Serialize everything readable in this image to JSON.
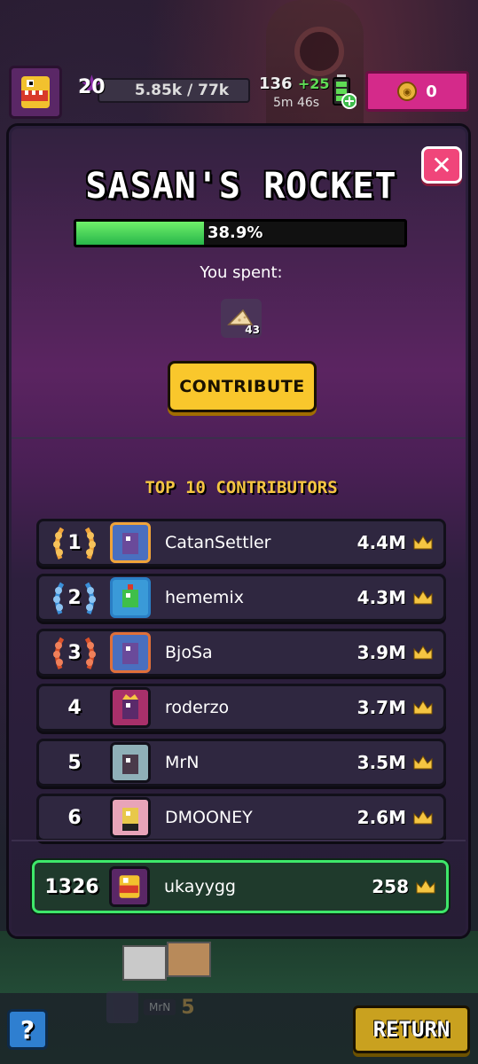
{
  "hud": {
    "level": "20",
    "xp": "5.85k / 77k",
    "energy": "136",
    "energy_plus": "+25",
    "timer": "5m 46s",
    "coins": "0"
  },
  "modal": {
    "title": "SASAN'S ROCKET",
    "progress_text": "38.9%",
    "progress_value": 38.9,
    "spent_label": "You spent:",
    "spent_count": "43",
    "contribute_label": "CONTRIBUTE",
    "close_label": "✕",
    "top_title": "TOP 10 CONTRIBUTORS"
  },
  "contributors": [
    {
      "rank": "1",
      "name": "CatanSettler",
      "score": "4.4M"
    },
    {
      "rank": "2",
      "name": "hememix",
      "score": "4.3M"
    },
    {
      "rank": "3",
      "name": "BjoSa",
      "score": "3.9M"
    },
    {
      "rank": "4",
      "name": "roderzo",
      "score": "3.7M"
    },
    {
      "rank": "5",
      "name": "MrN",
      "score": "3.5M"
    },
    {
      "rank": "6",
      "name": "DMOONEY",
      "score": "2.6M"
    }
  ],
  "self": {
    "rank": "1326",
    "name": "ukayygg",
    "score": "258"
  },
  "bottom": {
    "help_label": "?",
    "return_label": "RETURN",
    "ghost_name": "MrN",
    "ghost_rank": "5"
  },
  "colors": {
    "progress_fill": "#28b64a",
    "contribute_bg": "#f9c72c",
    "close_bg": "#f0457a",
    "self_border": "#3ee86a",
    "gold": "#f5c542"
  }
}
